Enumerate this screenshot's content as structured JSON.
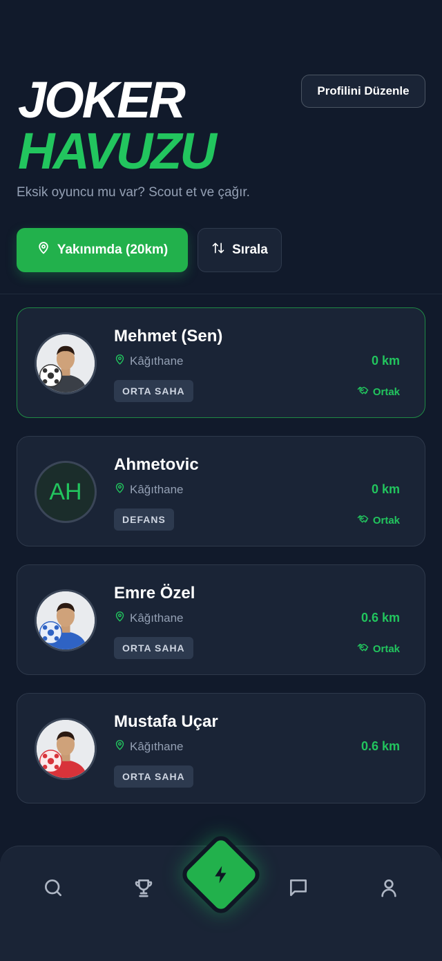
{
  "header": {
    "title_line1": "JOKER",
    "title_line2": "HAVUZU",
    "subtitle": "Eksik oyuncu mu var? Scout et ve çağır.",
    "edit_profile_label": "Profilini Düzenle"
  },
  "filters": {
    "nearby_label": "Yakınımda (20km)",
    "sort_label": "Sırala"
  },
  "players": [
    {
      "name": "Mehmet (Sen)",
      "location": "Kâğıthane",
      "position": "ORTA SAHA",
      "distance": "0 km",
      "badge": "Ortak",
      "avatar": "player-photo-dark-jersey"
    },
    {
      "name": "Ahmetovic",
      "location": "Kâğıthane",
      "position": "DEFANS",
      "distance": "0 km",
      "badge": "Ortak",
      "initials": "AH"
    },
    {
      "name": "Emre Özel",
      "location": "Kâğıthane",
      "position": "ORTA SAHA",
      "distance": "0.6 km",
      "badge": "Ortak",
      "avatar": "player-photo-blue-jersey"
    },
    {
      "name": "Mustafa Uçar",
      "location": "Kâğıthane",
      "position": "ORTA SAHA",
      "distance": "0.6 km",
      "avatar": "player-photo-red-jersey"
    }
  ],
  "nav": {
    "items": [
      "search-icon",
      "trophy-icon",
      "bolt-icon",
      "chat-icon",
      "user-icon"
    ]
  },
  "colors": {
    "background": "#111a2b",
    "card": "#1a2436",
    "accent": "#22c55e",
    "muted_text": "#94a0b4"
  }
}
